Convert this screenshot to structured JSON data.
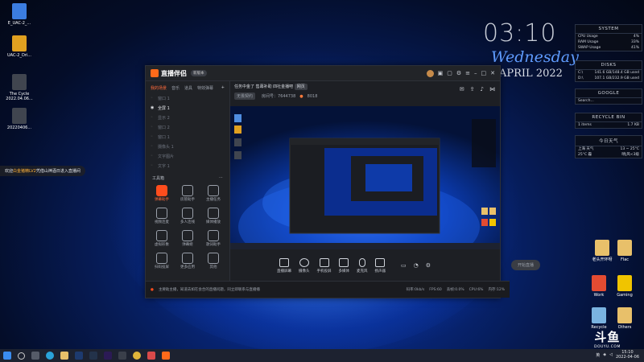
{
  "desktop_icons": [
    {
      "label": "E_UAC-2_...",
      "color": "#3b7de0"
    },
    {
      "label": "UAC-2_Dri...",
      "color": "#e0a020"
    },
    {
      "label": "The Cycle\n2022.04.06...",
      "color": "#40454f"
    },
    {
      "label": "20220406...",
      "color": "#40454f"
    }
  ],
  "right_icons": [
    {
      "label": "老头开环呀",
      "color": "#e8c06a"
    },
    {
      "label": "Flac",
      "color": "#e8c06a"
    },
    {
      "label": "Work",
      "color": "#e34b32"
    },
    {
      "label": "Gaming",
      "color": "#f0c400"
    },
    {
      "label": "Recycle",
      "color": "#7ab3e0"
    },
    {
      "label": "Others",
      "color": "#e8c06a"
    }
  ],
  "clock": {
    "time": "03:10",
    "day": "Wednesday",
    "date": "APRIL 2022"
  },
  "widgets": {
    "system": {
      "title": "SYSTEM",
      "rows": [
        [
          "CPU Usage",
          "4%"
        ],
        [
          "RAM Usage",
          "33%"
        ],
        [
          "SWAP Usage",
          "41%"
        ]
      ]
    },
    "disks": {
      "title": "DISKS",
      "rows": [
        [
          "C:\\",
          "141.6 GB/148.4 GB used"
        ],
        [
          "D:\\",
          "107.1 GB/232.9 GB used"
        ]
      ]
    },
    "google": {
      "title": "GOOGLE",
      "placeholder": "Search..."
    },
    "recycle": {
      "title": "RECYCLE BIN",
      "rows": [
        [
          "1 items",
          "1.7 KB"
        ]
      ]
    },
    "weather": {
      "title": "今日天气",
      "rows": [
        [
          "上海 天气",
          "13 ~ 25°C"
        ],
        [
          "25°C 霾",
          "晴|风<3级"
        ]
      ]
    }
  },
  "app": {
    "title": "直播伴侣",
    "version": "新版本",
    "sidebar_tabs": [
      "我的场景",
      "音乐",
      "道具",
      "特效弹幕"
    ],
    "scenes": [
      "窗口 1",
      "全屏 1",
      "显示 2",
      "窗口 2",
      "窗口 1",
      "摄像头 1",
      "文字图片",
      "文字 1"
    ],
    "tools_title": "工具箱",
    "tools": [
      "弹幕助手",
      "房管助手",
      "主播任务",
      "视频连麦",
      "多人连线",
      "媒体播放",
      "虚拟形象",
      "弹幕姬",
      "歌词助手",
      "扫码投屏",
      "更多应用",
      "其他"
    ],
    "stream_title": "任务中金了 售幕补助 四社金播吧",
    "stream_tag": "网页",
    "category": "无畏契约",
    "room": "房间号：7644738",
    "heat": "8018",
    "toolbar": [
      "直播屏幕",
      "摄像头",
      "手机投屏",
      "多媒体",
      "麦克风",
      "扬声器"
    ],
    "start_label": "开始直播",
    "status_text": "主要助主播，知道去如在会合的直播问题，同立即联系与直播播",
    "status_metrics": [
      "码率:0kb/s",
      "FPS:60",
      "丢帧:0.0%",
      "CPU:6%",
      "内存:12%"
    ]
  },
  "toast": {
    "prefix": "欢迎",
    "user": "白金猪精LV2",
    "suffix": "凭借山神酒日进入直播间"
  },
  "taskbar": {
    "time": "15:10",
    "date": "2022-04-06",
    "lang": "英"
  },
  "watermark": {
    "big": "斗鱼",
    "small": "DOUYU.COM"
  }
}
